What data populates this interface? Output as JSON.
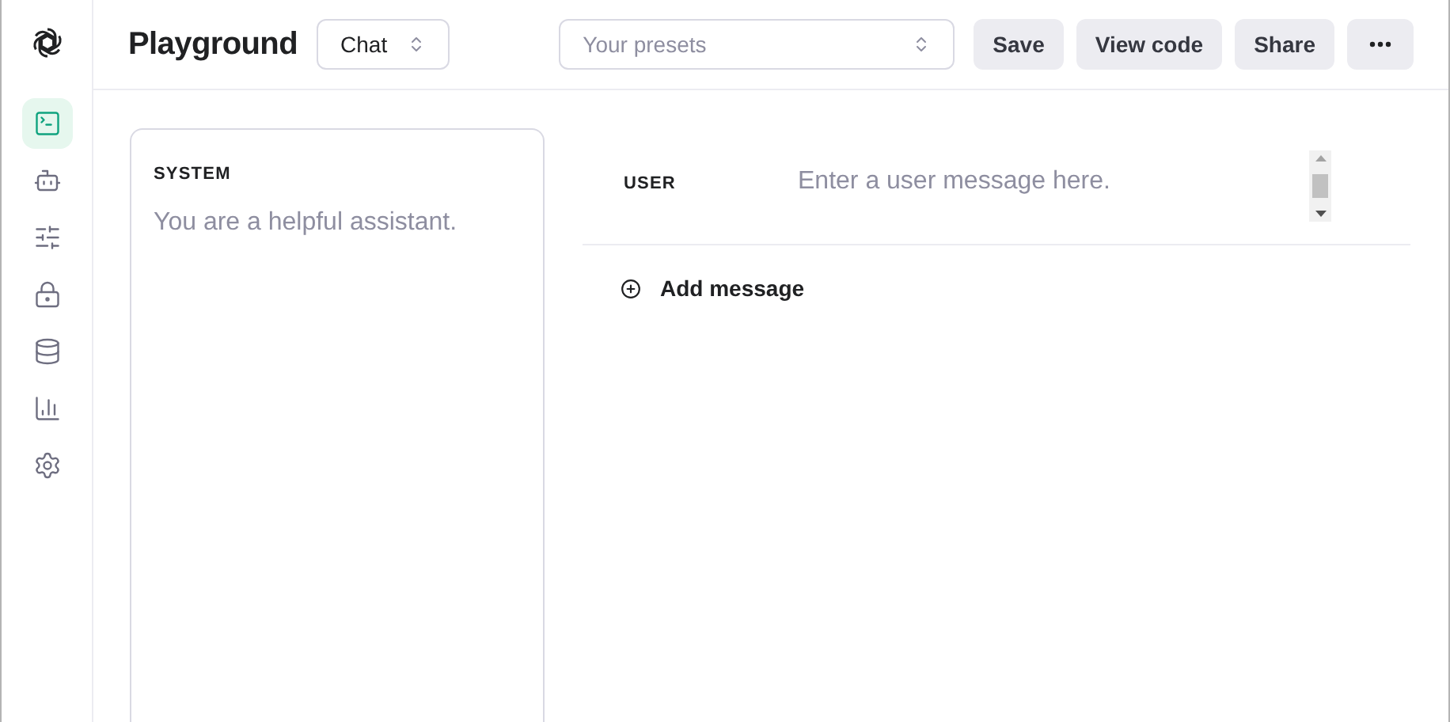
{
  "sidebar": {
    "items": [
      {
        "selected": true
      },
      {
        "selected": false
      },
      {
        "selected": false
      },
      {
        "selected": false
      },
      {
        "selected": false
      },
      {
        "selected": false
      },
      {
        "selected": false
      }
    ]
  },
  "header": {
    "title": "Playground",
    "mode": "Chat",
    "presets": {
      "placeholder": "Your presets"
    },
    "buttons": [
      "Save",
      "View code",
      "Share"
    ]
  },
  "system": {
    "label": "SYSTEM",
    "placeholder": "You are a helpful assistant."
  },
  "messages": [
    {
      "role": "USER",
      "placeholder": "Enter a user message here."
    }
  ],
  "add_message": "Add message"
}
